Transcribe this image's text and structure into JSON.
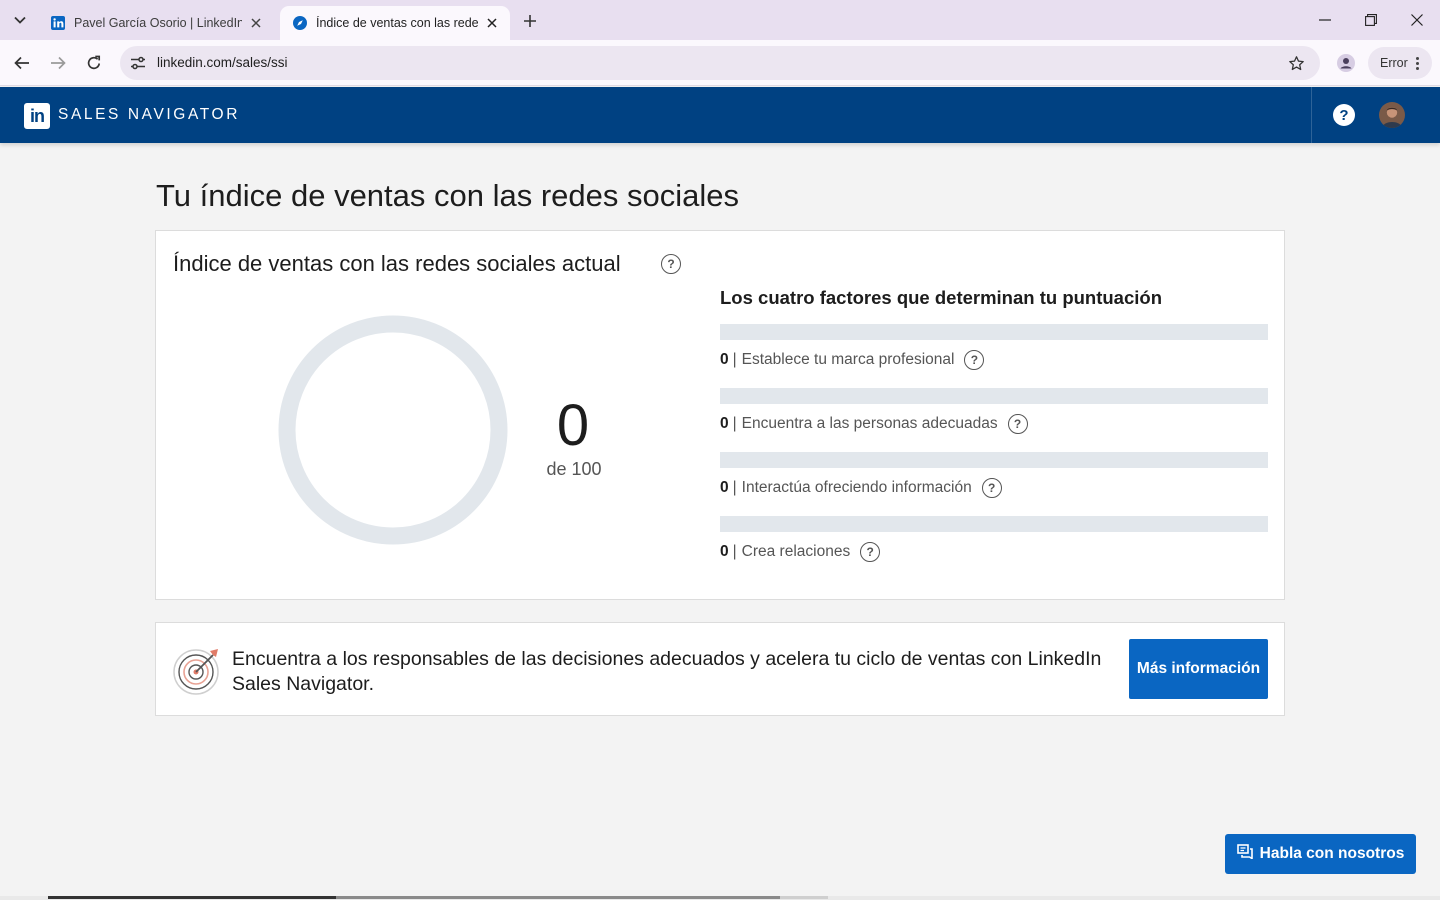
{
  "browser": {
    "tabs": [
      {
        "title": "Pavel García Osorio | LinkedIn",
        "favicon": "linkedin-icon",
        "active": false
      },
      {
        "title": "Índice de ventas con las redes sociales",
        "favicon": "compass-icon",
        "active": true
      }
    ],
    "address": "linkedin.com/sales/ssi",
    "error_label": "Error"
  },
  "appbar": {
    "brand": "SALES NAVIGATOR",
    "logo_text": "in",
    "help_label": "?"
  },
  "page": {
    "title": "Tu índice de ventas con las redes sociales"
  },
  "ssi": {
    "card_title": "Índice de ventas con las redes sociales actual",
    "score": "0",
    "score_max_label": "de 100",
    "score_fraction": 0,
    "factors_title": "Los cuatro factores que determinan tu puntuación",
    "factors": [
      {
        "score": "0",
        "separator": "|",
        "label": "Establece tu marca profesional",
        "fraction": 0
      },
      {
        "score": "0",
        "separator": "|",
        "label": "Encuentra a las personas adecuadas",
        "fraction": 0
      },
      {
        "score": "0",
        "separator": "|",
        "label": "Interactúa ofreciendo información",
        "fraction": 0
      },
      {
        "score": "0",
        "separator": "|",
        "label": "Crea relaciones",
        "fraction": 0
      }
    ]
  },
  "promo": {
    "text": "Encuentra a los responsables de las decisiones adecuados y acelera tu ciclo de ventas con LinkedIn Sales Navigator.",
    "button_label": "Más información"
  },
  "chat": {
    "button_label": "Habla con nosotros"
  },
  "colors": {
    "appbar": "#004182",
    "primary_button": "#0a66c2",
    "gauge_track": "#e2e7ec",
    "tab_strip": "#e8dff0"
  }
}
